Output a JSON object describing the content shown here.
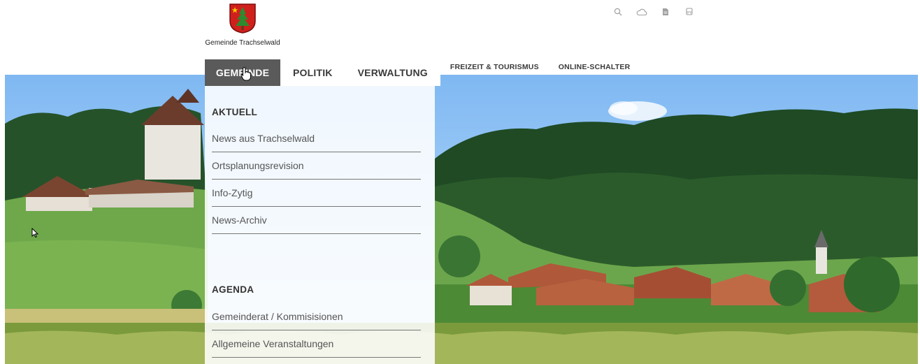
{
  "header": {
    "logo_text": "Gemeinde Trachselwald",
    "utility_icons": [
      "search-icon",
      "cloud-icon",
      "document-icon",
      "bus-icon"
    ]
  },
  "nav": {
    "items": [
      {
        "label": "GEMEINDE"
      },
      {
        "label": "POLITIK"
      },
      {
        "label": "VERWALTUNG"
      },
      {
        "label": "FREIZEIT & TOURISMUS"
      },
      {
        "label": "ONLINE-SCHALTER"
      }
    ]
  },
  "dropdown": {
    "sections": [
      {
        "heading": "AKTUELL",
        "links": [
          "News aus Trachselwald",
          "Ortsplanungsrevision",
          "Info-Zytig",
          "News-Archiv"
        ]
      },
      {
        "heading": "AGENDA",
        "links": [
          "Gemeinderat / Kommisisionen",
          "Allgemeine Veranstaltungen"
        ]
      }
    ]
  },
  "colors": {
    "active_nav_bg": "#5a5a5a",
    "crest_red": "#d0201c",
    "crest_green": "#2f8a2f",
    "crest_star": "#f2c600"
  }
}
